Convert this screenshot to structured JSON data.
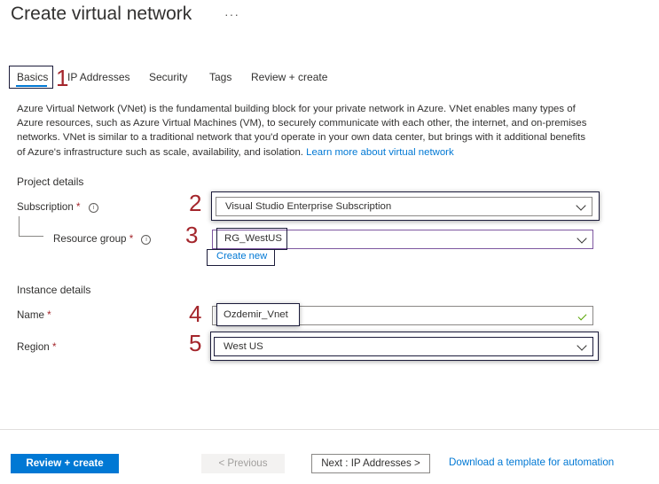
{
  "header": {
    "title": "Create virtual network",
    "more_label": "···"
  },
  "tabs": [
    {
      "label": "Basics"
    },
    {
      "label": "IP Addresses"
    },
    {
      "label": "Security"
    },
    {
      "label": "Tags"
    },
    {
      "label": "Review + create"
    }
  ],
  "annotations": {
    "n1": "1",
    "n2": "2",
    "n3": "3",
    "n4": "4",
    "n5": "5"
  },
  "description": {
    "text": "Azure Virtual Network (VNet) is the fundamental building block for your private network in Azure. VNet enables many types of Azure resources, such as Azure Virtual Machines (VM), to securely communicate with each other, the internet, and on-premises networks. VNet is similar to a traditional network that you'd operate in your own data center, but brings with it additional benefits of Azure's infrastructure such as scale, availability, and isolation.",
    "link": "Learn more about virtual network"
  },
  "project": {
    "heading": "Project details",
    "subscription_label": "Subscription",
    "subscription_value": "Visual Studio Enterprise Subscription",
    "rg_label": "Resource group",
    "rg_value": "RG_WestUS",
    "create_new": "Create new"
  },
  "instance": {
    "heading": "Instance details",
    "name_label": "Name",
    "name_value": "Ozdemir_Vnet",
    "region_label": "Region",
    "region_value": "West US"
  },
  "required_mark": "*",
  "info_glyph": "i",
  "footer": {
    "review_create": "Review + create",
    "previous": "< Previous",
    "next": "Next : IP Addresses >",
    "download": "Download a template for automation"
  },
  "colors": {
    "accent": "#0078d4",
    "annotation": "#a4262c",
    "valid": "#57a300"
  },
  "icons": [
    "more-icon",
    "info-icon",
    "chevron-down-icon",
    "checkmark-icon"
  ]
}
